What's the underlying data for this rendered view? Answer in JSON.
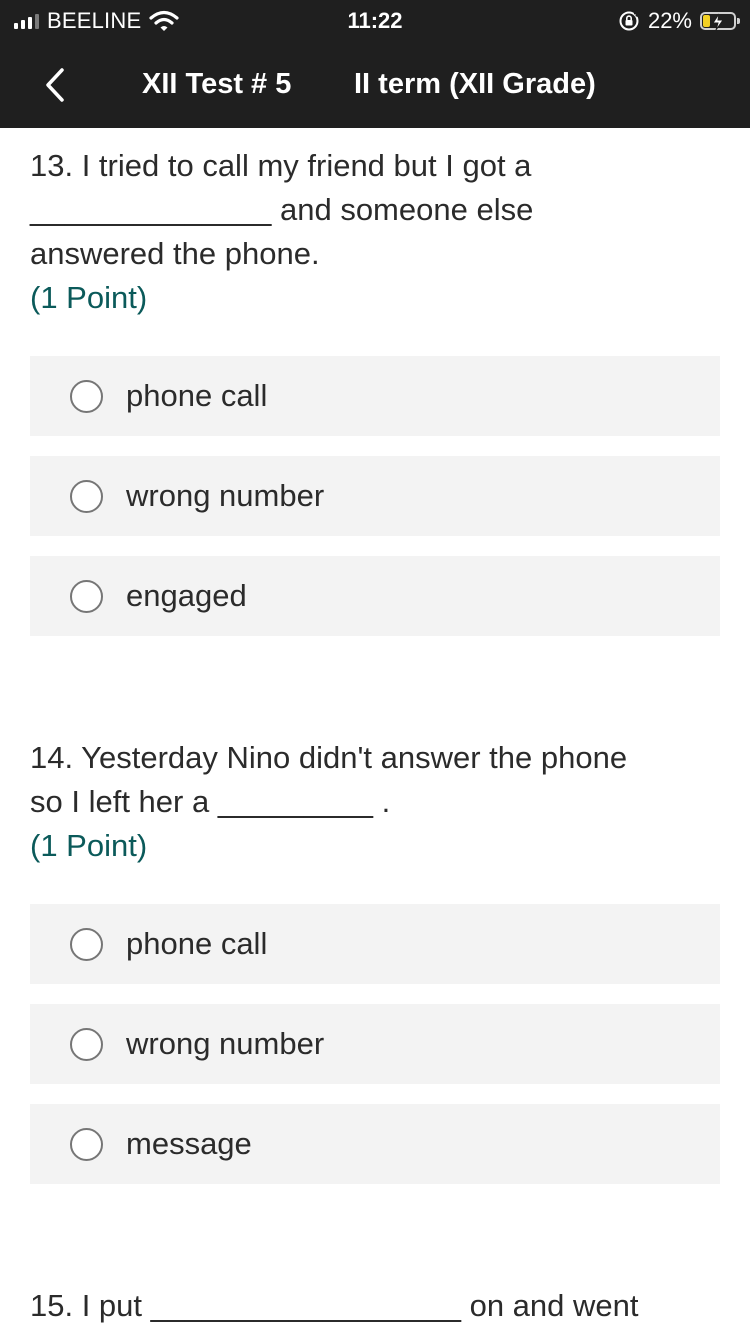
{
  "status_bar": {
    "carrier": "BEELINE",
    "time": "11:22",
    "battery": "22%",
    "battery_level_percent": 22,
    "icons": [
      "signal-icon",
      "wifi-icon",
      "orientation-lock-icon",
      "battery-charging-icon"
    ]
  },
  "nav": {
    "back_icon": "chevron-left-icon",
    "title": "XII Test # 5",
    "subtitle": "II term (XII Grade)"
  },
  "colors": {
    "header_bg": "#1f1f1f",
    "points_text": "#0b5a5a",
    "option_bg": "#f3f3f3",
    "battery_fill": "#f2d024"
  },
  "questions": [
    {
      "line1": "13. I tried to call my friend but I got a",
      "line2": "______________ and someone else",
      "line3": "answered the phone.",
      "points": "(1 Point)",
      "options": [
        {
          "label": "phone call",
          "selected": false
        },
        {
          "label": "wrong number",
          "selected": false
        },
        {
          "label": "engaged",
          "selected": false
        }
      ]
    },
    {
      "line1": "14. Yesterday Nino didn't answer the phone",
      "line2": "so I left her a _________ .",
      "points": "(1 Point)",
      "options": [
        {
          "label": "phone call",
          "selected": false
        },
        {
          "label": "wrong number",
          "selected": false
        },
        {
          "label": "message",
          "selected": false
        }
      ]
    },
    {
      "line1": "15. I put __________________ on and went"
    }
  ]
}
